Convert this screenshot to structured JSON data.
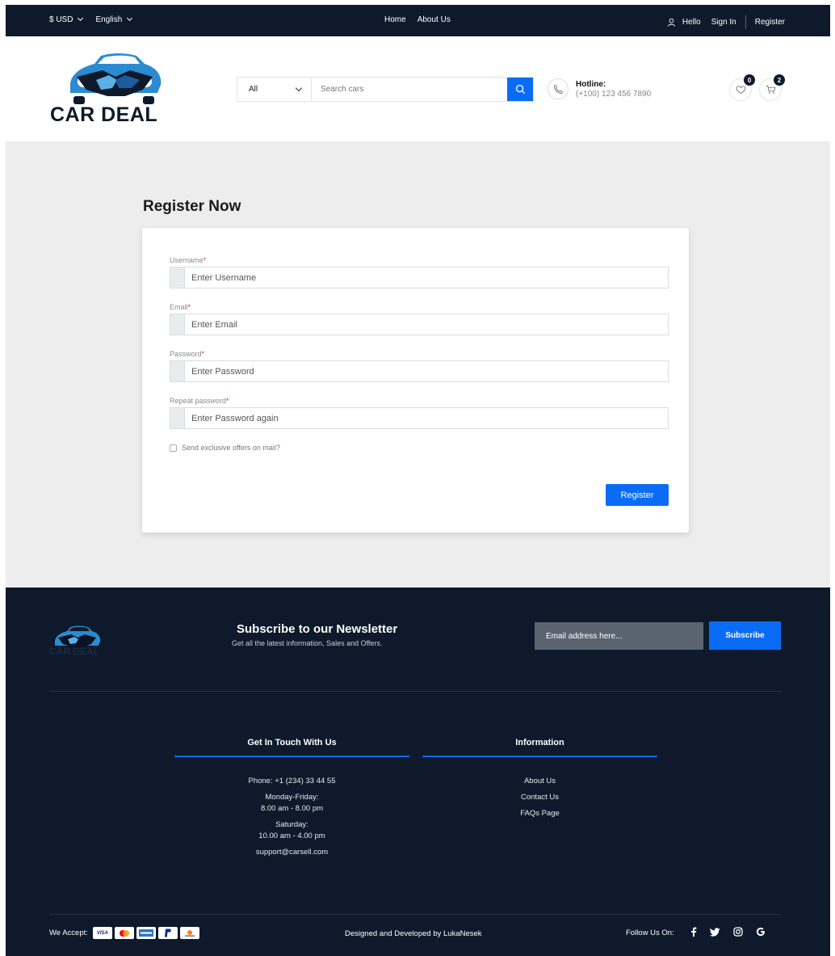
{
  "topbar": {
    "currency": "$ USD",
    "language": "English",
    "nav": [
      "Home",
      "About Us"
    ],
    "greeting": "Hello",
    "sign_in": "Sign In",
    "register": "Register"
  },
  "header": {
    "logo_text": "CAR DEAL",
    "search_category": "All",
    "search_placeholder": "Search cars",
    "hotline_title": "Hotline:",
    "hotline_number": "(+100) 123 456 7890",
    "wishlist_count": "0",
    "cart_count": "2"
  },
  "form": {
    "title": "Register Now",
    "fields": [
      {
        "label": "Username",
        "placeholder": "Enter Username"
      },
      {
        "label": "Email",
        "placeholder": "Enter Email"
      },
      {
        "label": "Password",
        "placeholder": "Enter Password"
      },
      {
        "label": "Repeat password",
        "placeholder": "Enter Password again"
      }
    ],
    "required_mark": "*",
    "checkbox_label": "Send exclusive offers on mail?",
    "submit": "Register"
  },
  "footer": {
    "logo_text": "CAR DEAL",
    "newsletter_title": "Subscribe to our Newsletter",
    "newsletter_sub": "Get all the latest information, Sales and Offers.",
    "email_placeholder": "Email address here...",
    "subscribe": "Subscribe",
    "contact_title": "Get In Touch With Us",
    "contact": {
      "phone": "Phone: +1 (234) 33 44 55",
      "weekdays": "Monday-Friday:",
      "weekday_hours": "8.00 am - 8.00 pm",
      "saturday": "Saturday:",
      "saturday_hours": "10.00 am - 4.00 pm",
      "email": "support@carsell.com"
    },
    "info_title": "Information",
    "info_links": [
      "About Us",
      "Contact Us",
      "FAQs Page"
    ],
    "we_accept": "We Accept:",
    "payment_cards": [
      "VISA",
      "mastercard",
      "AMEX",
      "PayPal",
      "Discover"
    ],
    "credit": "Designed and Developed by LukaNesek",
    "follow": "Follow Us On:",
    "social": [
      "facebook-icon",
      "twitter-icon",
      "instagram-icon",
      "google-icon"
    ]
  },
  "colors": {
    "navy": "#0e1a2b",
    "accent": "#0a6cf5",
    "page_bg": "#ededed"
  }
}
